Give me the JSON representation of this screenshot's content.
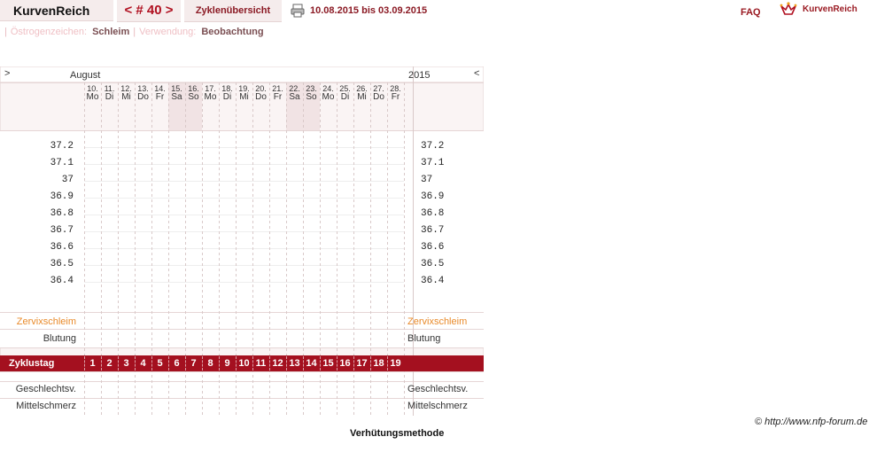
{
  "topbar": {
    "brand": "KurvenReich",
    "cycle_nav": "< # 40 >",
    "overview": "Zyklenübersicht",
    "date_range": "10.08.2015 bis 03.09.2015",
    "faq": "FAQ",
    "logo_text": "KurvenReich",
    "print_icon": "printer-icon",
    "logo_icon": "kurvenreich-logo-icon"
  },
  "subbar": {
    "estrogen_label": "Östrogenzeichen:",
    "estrogen_value": "Schleim",
    "usage_label": "Verwendung:",
    "usage_value": "Beobachtung"
  },
  "chart": {
    "nav_prev": ">",
    "nav_next": "<",
    "month": "August",
    "year": "2015",
    "days": [
      {
        "d": "10.",
        "w": "Mo"
      },
      {
        "d": "11.",
        "w": "Di"
      },
      {
        "d": "12.",
        "w": "Mi"
      },
      {
        "d": "13.",
        "w": "Do"
      },
      {
        "d": "14.",
        "w": "Fr"
      },
      {
        "d": "15.",
        "w": "Sa"
      },
      {
        "d": "16.",
        "w": "So"
      },
      {
        "d": "17.",
        "w": "Mo"
      },
      {
        "d": "18.",
        "w": "Di"
      },
      {
        "d": "19.",
        "w": "Mi"
      },
      {
        "d": "20.",
        "w": "Do"
      },
      {
        "d": "21.",
        "w": "Fr"
      },
      {
        "d": "22.",
        "w": "Sa"
      },
      {
        "d": "23.",
        "w": "So"
      },
      {
        "d": "24.",
        "w": "Mo"
      },
      {
        "d": "25.",
        "w": "Di"
      },
      {
        "d": "26.",
        "w": "Mi"
      },
      {
        "d": "27.",
        "w": "Do"
      },
      {
        "d": "28.",
        "w": "Fr"
      }
    ],
    "temperature_ticks": [
      "37.2",
      "37.1",
      "37",
      "36.9",
      "36.8",
      "36.7",
      "36.6",
      "36.5",
      "36.4"
    ],
    "rows": {
      "zervix": "Zervixschleim",
      "blutung": "Blutung",
      "zyklustag": "Zyklustag",
      "geschlechtsv": "Geschlechtsv.",
      "mittelschmerz": "Mittelschmerz"
    },
    "cycle_days": [
      "1",
      "2",
      "3",
      "4",
      "5",
      "6",
      "7",
      "8",
      "9",
      "10",
      "11",
      "12",
      "13",
      "14",
      "15",
      "16",
      "17",
      "18",
      "19"
    ],
    "colors": {
      "accent": "#a4101f",
      "zervix": "#e98a2a",
      "weekend": "#f1e3e4"
    }
  },
  "footer": {
    "copyright": "© http://www.nfp-forum.de",
    "method": "Verhütungsmethode"
  }
}
